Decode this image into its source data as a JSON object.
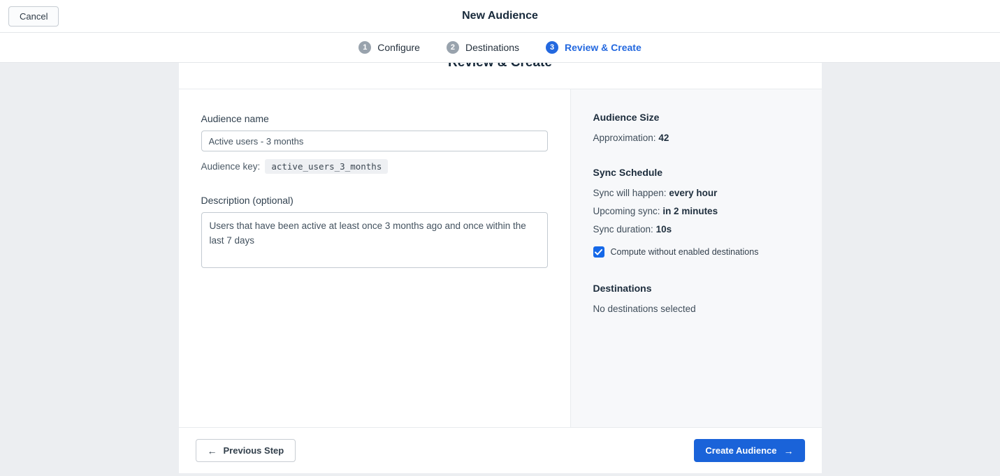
{
  "header": {
    "cancel_label": "Cancel",
    "title": "New Audience"
  },
  "stepper": {
    "steps": [
      {
        "num": "1",
        "label": "Configure",
        "active": false
      },
      {
        "num": "2",
        "label": "Destinations",
        "active": false
      },
      {
        "num": "3",
        "label": "Review & Create",
        "active": true
      }
    ]
  },
  "card": {
    "title": "Review & Create",
    "form": {
      "audience_name_label": "Audience name",
      "audience_name_value": "Active users - 3 months",
      "audience_key_label": "Audience key:",
      "audience_key_value": "active_users_3_months",
      "description_label": "Description (optional)",
      "description_value": "Users that have been active at least once 3 months ago and once within the last 7 days"
    },
    "summary": {
      "audience_size_heading": "Audience Size",
      "approximation_label": "Approximation:",
      "approximation_value": "42",
      "sync_heading": "Sync Schedule",
      "sync_rows": [
        {
          "label": "Sync will happen:",
          "value": "every hour"
        },
        {
          "label": "Upcoming sync:",
          "value": "in 2 minutes"
        },
        {
          "label": "Sync duration:",
          "value": "10s"
        }
      ],
      "compute_checkbox_label": "Compute without enabled destinations",
      "compute_checkbox_checked": true,
      "destinations_heading": "Destinations",
      "destinations_value": "No destinations selected"
    },
    "footer": {
      "previous_label": "Previous Step",
      "create_label": "Create Audience"
    }
  },
  "colors": {
    "accent": "#2368df",
    "primary_button": "#1a63d9",
    "step_inactive": "#99a3ad",
    "checkbox": "#1568e8"
  }
}
